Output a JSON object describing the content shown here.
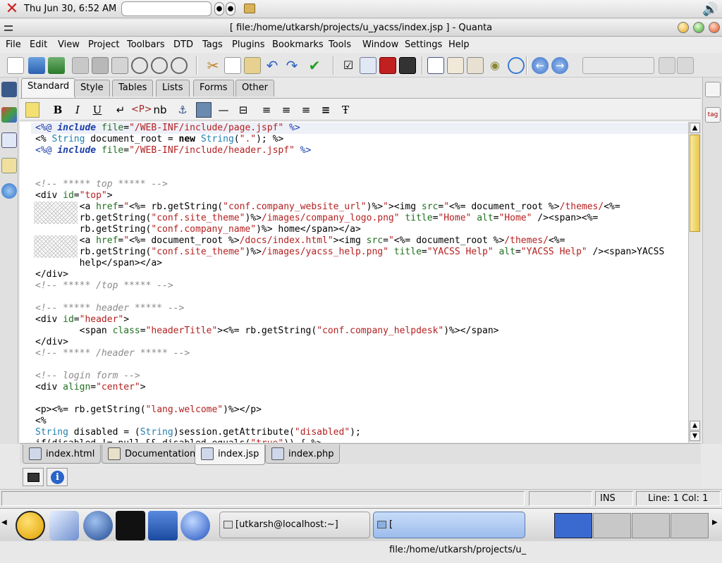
{
  "top_panel": {
    "clock": "Thu Jun 30,  6:52 AM",
    "run_placeholder": ""
  },
  "window": {
    "title": "[  file:/home/utkarsh/projects/u_yacss/index.jsp  ]   - Quanta"
  },
  "menu": [
    "File",
    "Edit",
    "View",
    "Project",
    "Toolbars",
    "DTD",
    "Tags",
    "Plugins",
    "Bookmarks",
    "Tools",
    "Window",
    "Settings",
    "Help"
  ],
  "group_tabs": [
    "Standard",
    "Style",
    "Tables",
    "Lists",
    "Forms",
    "Other"
  ],
  "active_group_tab": "Standard",
  "format_toolbar": {
    "bold": "B",
    "italic": "I",
    "underline": "U",
    "nbsp": "nb",
    "para": "<P>"
  },
  "right_panel": {
    "tag_label": "tag"
  },
  "file_tabs": [
    "index.html",
    "Documentation",
    "index.jsp",
    "index.php"
  ],
  "active_file_tab": "index.jsp",
  "status": {
    "mode": "INS",
    "position": "Line: 1 Col: 1"
  },
  "taskbar": {
    "tasks": [
      "[utkarsh@localhost:~]",
      "[  file:/home/utkarsh/projects/u_"
    ]
  },
  "colors": {
    "keyword": "#1a3ea8",
    "string": "#b52020",
    "attribute": "#207020",
    "comment": "#8a8a8a",
    "type": "#2080b0"
  }
}
